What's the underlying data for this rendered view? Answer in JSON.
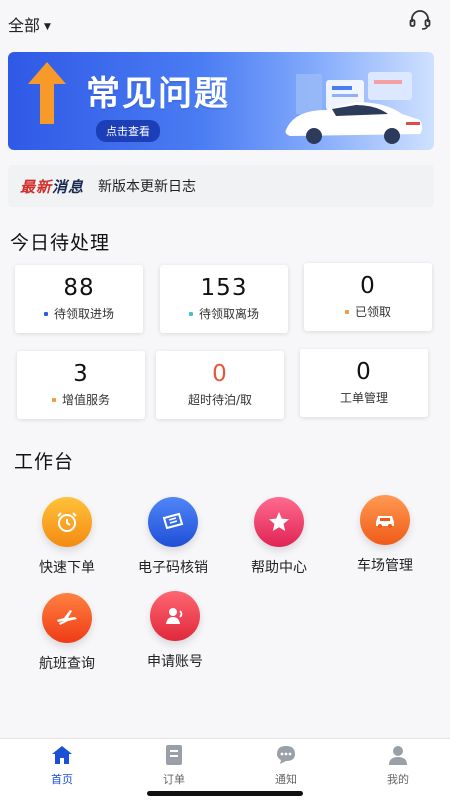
{
  "header": {
    "filter_label": "全部"
  },
  "banner": {
    "title": "常见问题",
    "cta": "点击查看"
  },
  "news": {
    "tag_prefix": "最新",
    "tag_suffix": "消息",
    "text": "新版本更新日志"
  },
  "today": {
    "title": "今日待处理",
    "stats": [
      {
        "value": "88",
        "label": "待领取进场",
        "dot_color": "#2a62d8"
      },
      {
        "value": "153",
        "label": "待领取离场",
        "dot_color": "#3fc1d2"
      },
      {
        "value": "0",
        "label": "已领取",
        "dot_color": "#f29a4a"
      },
      {
        "value": "3",
        "label": "增值服务",
        "dot_color": "#f29a4a"
      },
      {
        "value": "0",
        "label": "超时待泊/取",
        "dot_color": ""
      },
      {
        "value": "0",
        "label": "工单管理",
        "dot_color": ""
      }
    ]
  },
  "workbench": {
    "title": "工作台",
    "tools": [
      {
        "label": "快速下单",
        "icon": "alarm-clock-icon",
        "color": "#f7a21b"
      },
      {
        "label": "电子码核销",
        "icon": "ticket-icon",
        "color": "#2f62e3"
      },
      {
        "label": "帮助中心",
        "icon": "star-icon",
        "color": "#ef3e6f"
      },
      {
        "label": "车场管理",
        "icon": "car-icon",
        "color": "#f7702a"
      },
      {
        "label": "航班查询",
        "icon": "airplane-icon",
        "color": "#f55a2c"
      },
      {
        "label": "申请账号",
        "icon": "user-icon",
        "color": "#ee3d55"
      }
    ]
  },
  "tabs": [
    {
      "label": "首页",
      "active": true
    },
    {
      "label": "订单",
      "active": false
    },
    {
      "label": "通知",
      "active": false
    },
    {
      "label": "我的",
      "active": false
    }
  ],
  "colors": {
    "accent": "#1a4fd6",
    "inactive_tab": "#9aa0a8"
  }
}
